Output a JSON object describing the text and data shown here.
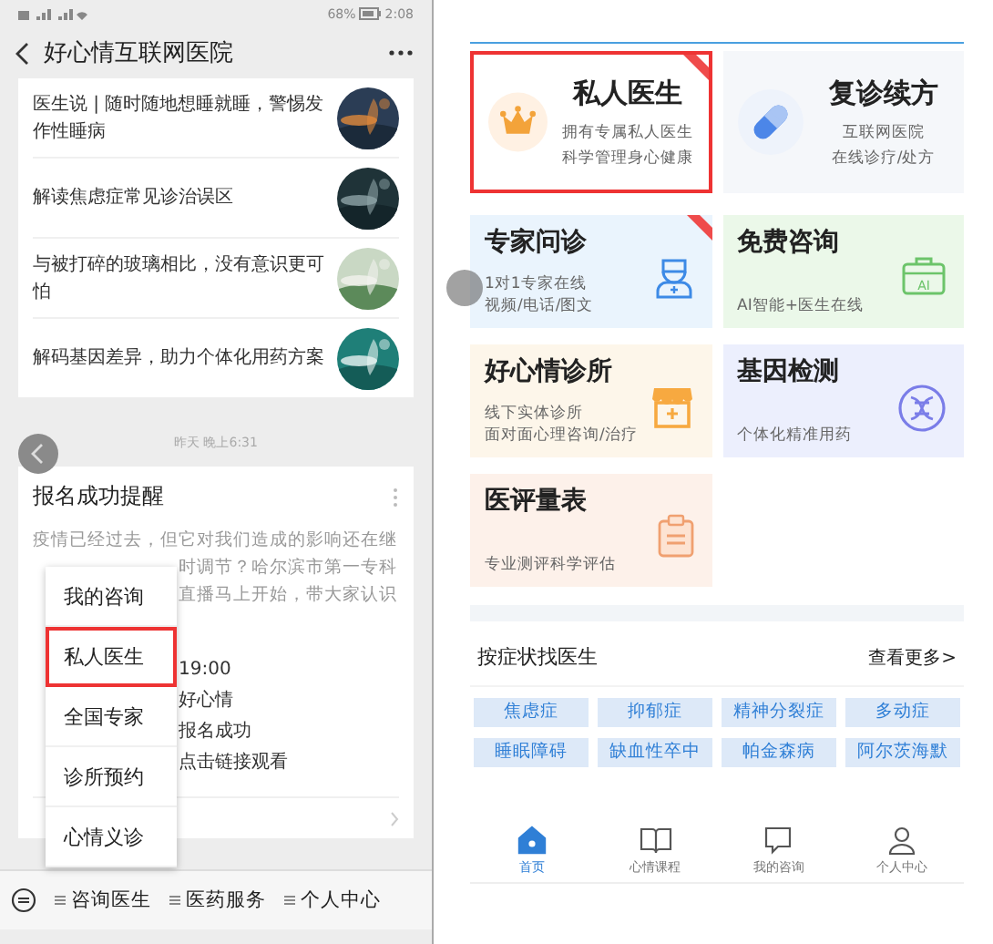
{
  "left": {
    "status_bar": {
      "battery": "68%",
      "time": "2:08"
    },
    "header": {
      "title": "好心情互联网医院"
    },
    "articles": [
      {
        "title": "医生说 | 随时随地想睡就睡，警惕发作性睡病"
      },
      {
        "title": "解读焦虑症常见诊治误区"
      },
      {
        "title": "与被打碎的玻璃相比，没有意识更可怕"
      },
      {
        "title": "解码基因差异，助力个体化用药方案"
      }
    ],
    "timestamp": "昨天 晚上6:31",
    "message": {
      "title": "报名成功提醒",
      "first_line": "疫情已经过去，但它对我们造成的影响还在继",
      "lines": [
        "时调节？哈尔滨市第一专科",
        "直播马上开始，带大家认识"
      ],
      "fields": [
        "19:00",
        "好心情",
        "报名成功",
        "点击链接观看"
      ]
    },
    "popup_menu": [
      {
        "label": "我的咨询",
        "selected": false
      },
      {
        "label": "私人医生",
        "selected": true
      },
      {
        "label": "全国专家",
        "selected": false
      },
      {
        "label": "诊所预约",
        "selected": false
      },
      {
        "label": "心情义诊",
        "selected": false
      }
    ],
    "bottom_menu": [
      "咨询医生",
      "医药服务",
      "个人中心"
    ]
  },
  "right": {
    "featured": [
      {
        "title": "私人医生",
        "desc": [
          "拥有专属私人医生",
          "科学管理身心健康"
        ],
        "kind": "crown",
        "ribbon": true,
        "selected": true
      },
      {
        "title": "复诊续方",
        "desc": [
          "互联网医院",
          "在线诊疗/处方"
        ],
        "kind": "pill",
        "ribbon": false,
        "selected": false
      }
    ],
    "services": [
      {
        "title": "专家问诊",
        "desc": [
          "1对1专家在线",
          "视频/电话/图文"
        ],
        "kind": "nurse",
        "ribbon": true
      },
      {
        "title": "免费咨询",
        "desc": [
          "AI智能+医生在线"
        ],
        "kind": "ai",
        "icon_text": "AI",
        "ribbon": false
      },
      {
        "title": "好心情诊所",
        "desc": [
          "线下实体诊所",
          "面对面心理咨询/治疗"
        ],
        "kind": "store",
        "ribbon": false
      },
      {
        "title": "基因检测",
        "desc": [
          "个体化精准用药"
        ],
        "kind": "dna",
        "ribbon": false
      },
      {
        "title": "医评量表",
        "desc": [
          "专业测评科学评估"
        ],
        "kind": "clipboard",
        "ribbon": false
      }
    ],
    "symptoms": {
      "title": "按症状找医生",
      "more": "查看更多>",
      "tags": [
        "焦虑症",
        "抑郁症",
        "精神分裂症",
        "多动症",
        "睡眠障碍",
        "缺血性卒中",
        "帕金森病",
        "阿尔茨海默"
      ]
    },
    "tabs": [
      {
        "label": "首页",
        "kind": "home",
        "selected": true
      },
      {
        "label": "心情课程",
        "kind": "book",
        "selected": false
      },
      {
        "label": "我的咨询",
        "kind": "chat",
        "selected": false
      },
      {
        "label": "个人中心",
        "kind": "person",
        "selected": false
      }
    ]
  }
}
